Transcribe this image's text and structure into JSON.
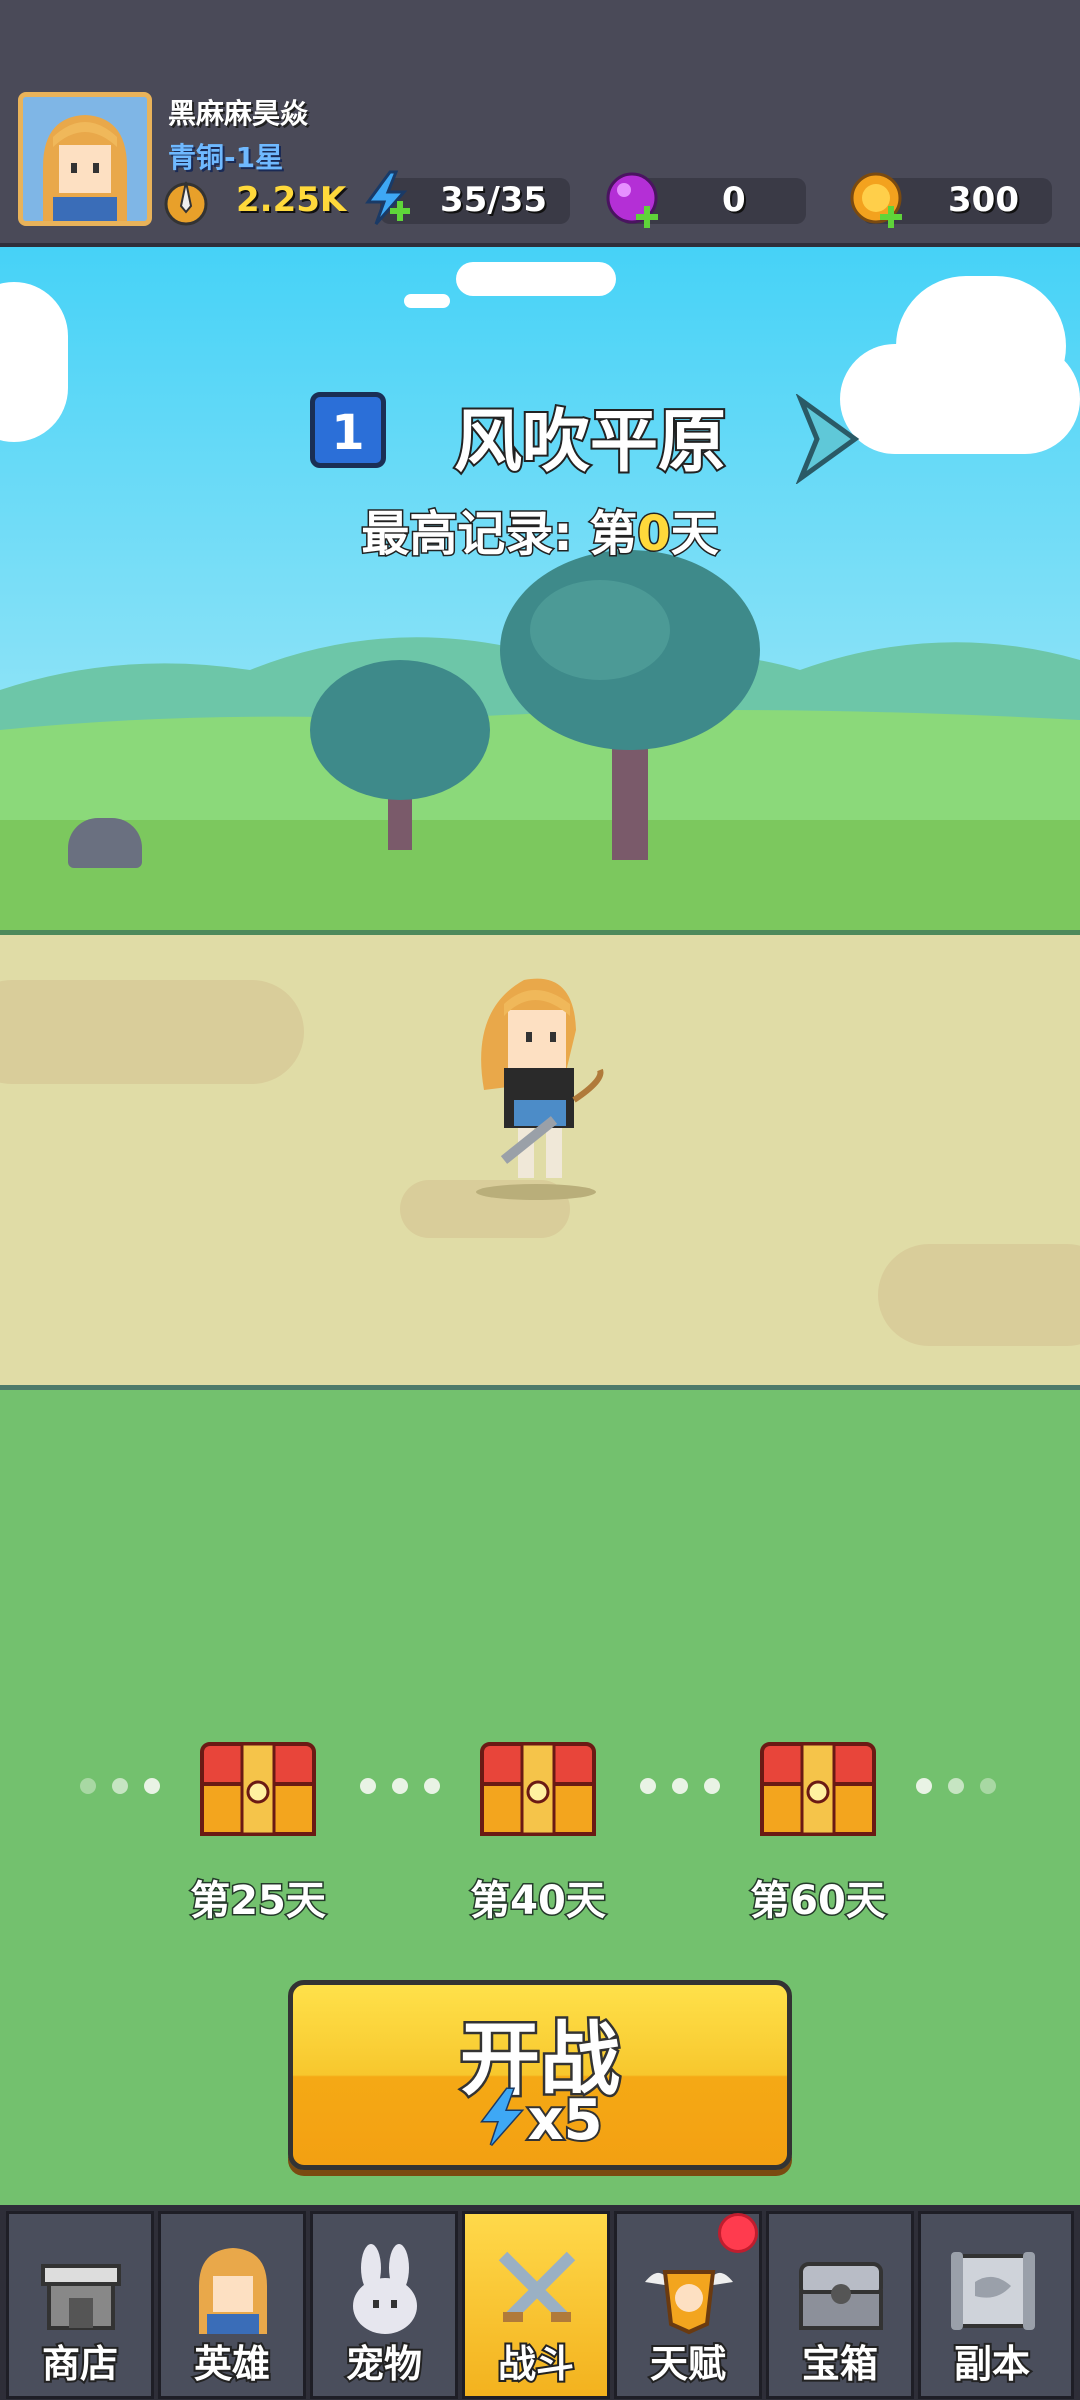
{
  "player": {
    "name": "黑麻麻昊焱",
    "rank": "青铜-1星",
    "power": "2.25K",
    "energy": "35/35",
    "gems": "0",
    "coins": "300"
  },
  "level": {
    "number": "1",
    "name": "风吹平原",
    "record_prefix": "最高记录: 第",
    "record_day": "0",
    "record_suffix": "天"
  },
  "milestones": [
    {
      "label": "第25天"
    },
    {
      "label": "第40天"
    },
    {
      "label": "第60天"
    }
  ],
  "start_button": {
    "label": "开战",
    "cost": "x5"
  },
  "nav": [
    {
      "label": "商店",
      "icon": "shop-icon"
    },
    {
      "label": "英雄",
      "icon": "hero-icon"
    },
    {
      "label": "宠物",
      "icon": "pet-icon"
    },
    {
      "label": "战斗",
      "icon": "battle-icon",
      "active": true
    },
    {
      "label": "天赋",
      "icon": "talent-icon",
      "badge": true
    },
    {
      "label": "宝箱",
      "icon": "chest-icon"
    },
    {
      "label": "副本",
      "icon": "dungeon-icon"
    }
  ],
  "colors": {
    "header": "#4a4a58",
    "sky": "#46d2f7",
    "road": "#e0dca6",
    "field": "#73c16e",
    "gold": "#ffd93b",
    "active_nav": "#f3b21e",
    "badge": "#ff3b4e"
  }
}
